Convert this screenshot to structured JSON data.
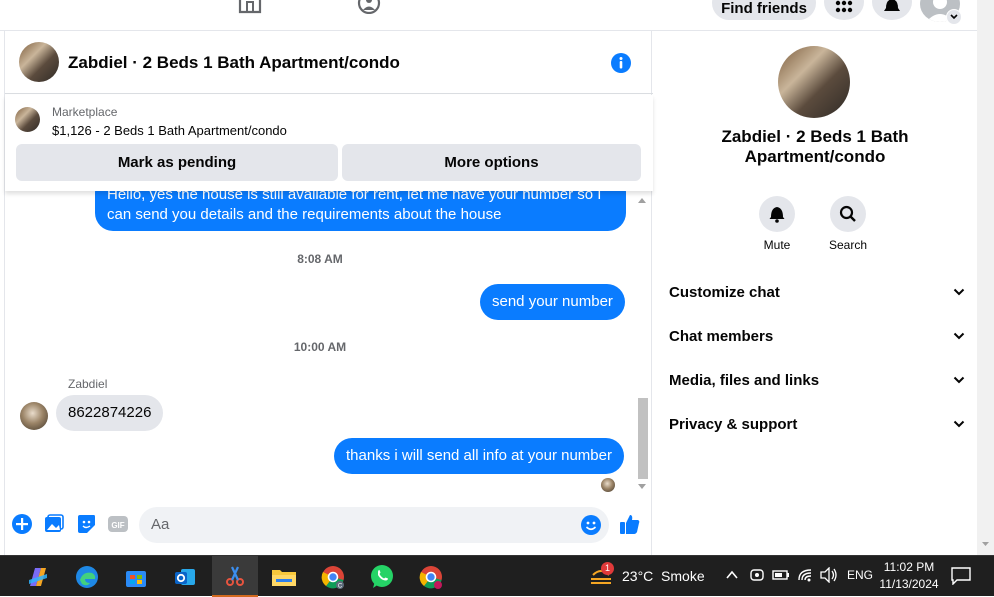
{
  "topbar": {
    "find_friends_label": "Find friends"
  },
  "chat": {
    "header_title": "Zabdiel · 2 Beds 1 Bath Apartment/condo",
    "marketplace": {
      "label": "Marketplace",
      "listing": "$1,126 - 2 Beds 1 Bath Apartment/condo",
      "mark_pending_label": "Mark as pending",
      "more_options_label": "More options"
    },
    "messages": {
      "m1_line1": "Hello, yes the house is still available for rent, let me have your number so I",
      "m1_line2": "can send you details and the requirements about the house",
      "time1": "8:08 AM",
      "m2": "send your number",
      "time2": "10:00 AM",
      "sender_name": "Zabdiel",
      "m3": "8622874226",
      "m4": "thanks i will send all info at your number"
    },
    "composer": {
      "placeholder": "Aa"
    }
  },
  "right_panel": {
    "title_line1": "Zabdiel · 2 Beds 1 Bath",
    "title_line2": "Apartment/condo",
    "mute_label": "Mute",
    "search_label": "Search",
    "sections": [
      "Customize chat",
      "Chat members",
      "Media, files and links",
      "Privacy & support"
    ]
  },
  "taskbar": {
    "weather_badge": "1",
    "weather": "23°C  Smoke",
    "language": "ENG",
    "time": "11:02 PM",
    "date": "11/13/2024"
  },
  "colors": {
    "accent": "#0a7cff",
    "incoming_bubble": "#e4e6eb",
    "taskbar": "#1f1f1f"
  }
}
